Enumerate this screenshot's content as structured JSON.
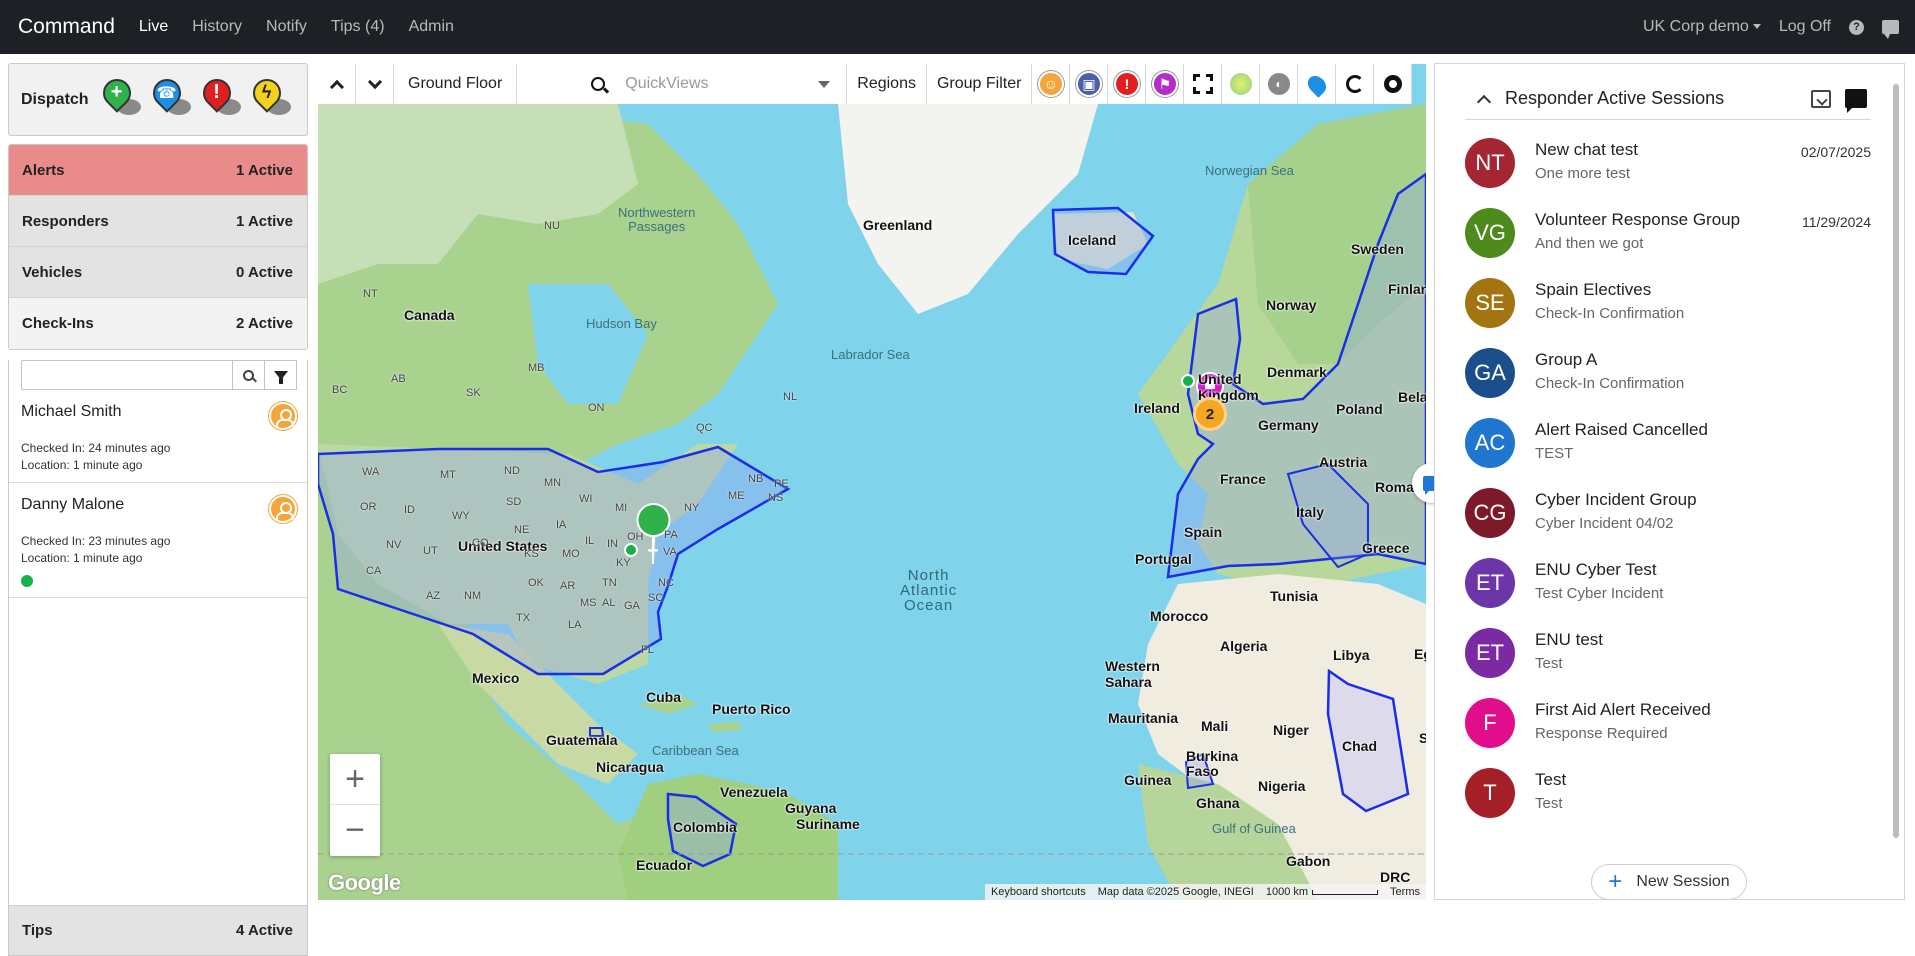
{
  "topbar": {
    "brand": "Command",
    "nav": [
      "Live",
      "History",
      "Notify",
      "Tips (4)",
      "Admin"
    ],
    "org": "UK Corp demo",
    "logoff": "Log Off",
    "help": "?"
  },
  "dispatch": {
    "label": "Dispatch",
    "icons": [
      "first-aid-pin-icon",
      "phone-pin-icon",
      "alert-pin-icon",
      "lightning-pin-icon"
    ],
    "colors": [
      "#2fb24a",
      "#1c8ee6",
      "#e02020",
      "#f2d21b"
    ]
  },
  "summary": {
    "alerts": {
      "label": "Alerts",
      "count": "1 Active"
    },
    "responders": {
      "label": "Responders",
      "count": "1 Active"
    },
    "vehicles": {
      "label": "Vehicles",
      "count": "0 Active"
    },
    "checkins": {
      "label": "Check-Ins",
      "count": "2 Active"
    },
    "tips": {
      "label": "Tips",
      "count": "4 Active"
    }
  },
  "checkins": [
    {
      "name": "Michael Smith",
      "checked": "Checked In: 24 minutes ago",
      "location": "Location: 1 minute ago",
      "online": false
    },
    {
      "name": "Danny Malone",
      "checked": "Checked In: 23 minutes ago",
      "location": "Location: 1 minute ago",
      "online": true
    }
  ],
  "map": {
    "floor": "Ground Floor",
    "quickviews_placeholder": "QuickViews",
    "regions": "Regions",
    "group_filter": "Group Filter",
    "cluster_count": "2",
    "zoom_in": "+",
    "zoom_out": "−",
    "google": "Google",
    "attribution": {
      "shortcuts": "Keyboard shortcuts",
      "data": "Map data ©2025 Google, INEGI",
      "scale": "1000 km",
      "terms": "Terms"
    },
    "labels": {
      "greenland": "Greenland",
      "iceland": "Iceland",
      "canada": "Canada",
      "united_states": "United States",
      "mexico": "Mexico",
      "cuba": "Cuba",
      "puerto_rico": "Puerto Rico",
      "guatemala": "Guatemala",
      "nicaragua": "Nicaragua",
      "venezuela": "Venezuela",
      "guyana": "Guyana",
      "suriname": "Suriname",
      "colombia": "Colombia",
      "ecuador": "Ecuador",
      "norway": "Norway",
      "sweden": "Sweden",
      "finland": "Finlan",
      "denmark": "Denmark",
      "ireland": "Ireland",
      "united_kingdom": "United Kingdom",
      "germany": "Germany",
      "poland": "Poland",
      "belarus": "Bela",
      "france": "France",
      "austria": "Austria",
      "romania": "Roma",
      "italy": "Italy",
      "spain": "Spain",
      "portugal": "Portugal",
      "greece": "Greece",
      "tunisia": "Tunisia",
      "morocco": "Morocco",
      "algeria": "Algeria",
      "libya": "Libya",
      "egypt": "Eg",
      "western_sahara": "Western\nSahara",
      "mauritania": "Mauritania",
      "mali": "Mali",
      "niger": "Niger",
      "chad": "Chad",
      "sudan": "S",
      "burkina": "Burkina\nFaso",
      "guinea": "Guinea",
      "ghana": "Ghana",
      "nigeria": "Nigeria",
      "gabon": "Gabon",
      "drc": "DRC",
      "labrador_sea": "Labrador Sea",
      "hudson_bay": "Hudson Bay",
      "norwegian_sea": "Norwegian Sea",
      "caribbean_sea": "Caribbean Sea",
      "gulf_of_guinea": "Gulf of Guinea",
      "nw_passages": "Northwestern\nPassages",
      "north_atlantic": "North\nAtlantic\nOcean",
      "nu": "NU",
      "nt": "NT",
      "bc": "BC",
      "ab": "AB",
      "sk": "SK",
      "mb": "MB",
      "on": "ON",
      "qc": "QC",
      "nl": "NL",
      "nb": "NB",
      "pe": "PE",
      "ns": "NS",
      "me": "ME",
      "wa": "WA",
      "mt": "MT",
      "nd": "ND",
      "mn": "MN",
      "or": "OR",
      "id": "ID",
      "wy": "WY",
      "sd": "SD",
      "wi": "WI",
      "mi": "MI",
      "ny": "NY",
      "nv": "NV",
      "ut": "UT",
      "ne": "NE",
      "ia": "IA",
      "oh": "OH",
      "pa": "PA",
      "ca": "CA",
      "ks": "KS",
      "mo": "MO",
      "ky": "KY",
      "va": "VA",
      "co": "CO",
      "il": "IL",
      "in": "IN",
      "az": "AZ",
      "nm": "NM",
      "ok": "OK",
      "tn": "TN",
      "nc": "NC",
      "ar": "AR",
      "ms": "MS",
      "al": "AL",
      "ga": "GA",
      "sc": "SC",
      "tx": "TX",
      "la": "LA",
      "fl": "FL"
    }
  },
  "sessions": {
    "title": "Responder Active Sessions",
    "new_session": "New Session",
    "items": [
      {
        "initials": "NT",
        "name": "New chat test",
        "sub": "One more test",
        "date": "02/07/2025",
        "color": "#a32632"
      },
      {
        "initials": "VG",
        "name": "Volunteer Response Group",
        "sub": "And then we got",
        "date": "11/29/2024",
        "color": "#4f8a1c"
      },
      {
        "initials": "SE",
        "name": "Spain Electives",
        "sub": "Check-In Confirmation",
        "date": "",
        "color": "#a47410"
      },
      {
        "initials": "GA",
        "name": "Group A",
        "sub": "Check-In Confirmation",
        "date": "",
        "color": "#1b4f8c"
      },
      {
        "initials": "AC",
        "name": "Alert Raised Cancelled",
        "sub": "TEST",
        "date": "",
        "color": "#1f76cf"
      },
      {
        "initials": "CG",
        "name": "Cyber Incident Group",
        "sub": "Cyber Incident 04/02",
        "date": "",
        "color": "#7c1a2a"
      },
      {
        "initials": "ET",
        "name": "ENU Cyber Test",
        "sub": "Test Cyber Incident",
        "date": "",
        "color": "#6d36a8"
      },
      {
        "initials": "ET",
        "name": "ENU test",
        "sub": "Test",
        "date": "",
        "color": "#7b2aa4"
      },
      {
        "initials": "F",
        "name": "First Aid Alert Received",
        "sub": "Response Required",
        "date": "",
        "color": "#e10e8c"
      },
      {
        "initials": "T",
        "name": "Test",
        "sub": "Test",
        "date": "",
        "color": "#a51f28"
      }
    ]
  }
}
